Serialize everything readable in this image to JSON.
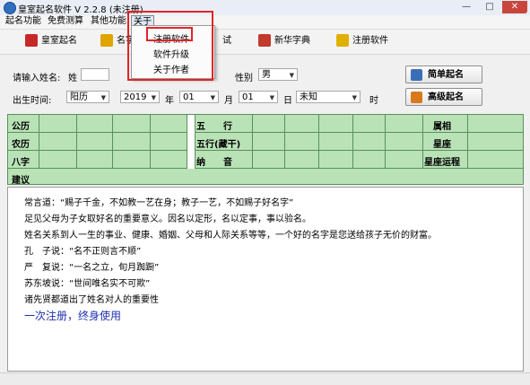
{
  "window": {
    "title": "皇室起名软件 V 2.2.8 (未注册)",
    "min_glyph": "—",
    "max_glyph": "□",
    "close_glyph": "✕"
  },
  "menubar": [
    "起名功能",
    "免费测算",
    "其他功能",
    "关于"
  ],
  "dropdown": {
    "items": [
      "注册软件",
      "软件升级",
      "关于作者"
    ]
  },
  "toolbar": {
    "items": [
      {
        "label": "皇室起名",
        "icon": "crown-icon",
        "color": "#c62828"
      },
      {
        "label": "名字",
        "icon": "pencil-icon",
        "color": "#e0a400"
      },
      {
        "label": "试",
        "icon": "",
        "color": ""
      },
      {
        "label": "新华字典",
        "icon": "dictionary-icon",
        "color": "#c0392b"
      },
      {
        "label": "注册软件",
        "icon": "lock-icon",
        "color": "#e0b000"
      }
    ]
  },
  "form": {
    "surname_label": "请输入姓名:",
    "surname_prefix": "姓",
    "surname_value": "",
    "gender_label": "性别",
    "gender_value": "男",
    "birth_label": "出生时间:",
    "calendar_value": "阳历",
    "year_value": "2019",
    "year_unit": "年",
    "month_value": "01",
    "month_unit": "月",
    "day_value": "01",
    "day_unit": "日",
    "hour_value": "未知",
    "hour_unit": "时",
    "simple_button": "简单起名",
    "advanced_button": "高级起名"
  },
  "grid": {
    "row1_left": "公历",
    "row2_left": "农历",
    "row3_left": "八字",
    "row4_left": "建议",
    "wuxing": "五　　行",
    "wuxing_ganzhi": "五行(藏干)",
    "nayin": "纳　　音",
    "shuxiang": "属相",
    "xingzuo": "星座",
    "xingzuo_yunqian": "星座运程"
  },
  "text_lines": [
    "常言道：“赐子千金，不如教一艺在身；教子一艺，不如赐子好名字”",
    "足见父母为子女取好名的重要意义。因名以定形，名以定事，事以验名。",
    "姓名关系到人一生的事业、健康、婚姻、父母和人际关系等等，一个好的名字是您送给孩子无价的财富。",
    "孔　子说：“名不正则言不顺”",
    "严　复说：“一名之立，旬月踟蹰”",
    "苏东坡说：“世间唯名实不可欺”",
    "诸先贤都道出了姓名对人的重要性"
  ],
  "promo": "一次注册，终身使用"
}
